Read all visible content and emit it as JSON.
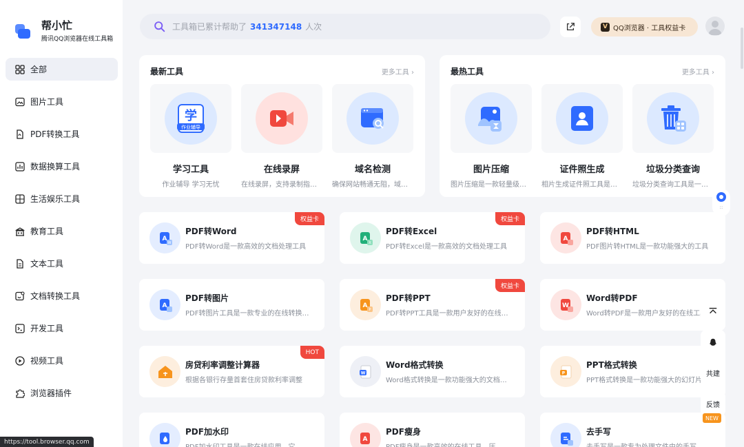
{
  "brand": {
    "title": "帮小忙",
    "subtitle": "腾讯QQ浏览器在线工具箱"
  },
  "nav": [
    {
      "label": "全部",
      "icon": "grid-icon",
      "active": true
    },
    {
      "label": "图片工具",
      "icon": "image-icon"
    },
    {
      "label": "PDF转换工具",
      "icon": "pdf-icon"
    },
    {
      "label": "数据换算工具",
      "icon": "chart-icon"
    },
    {
      "label": "生活娱乐工具",
      "icon": "gamepad-icon"
    },
    {
      "label": "教育工具",
      "icon": "building-icon"
    },
    {
      "label": "文本工具",
      "icon": "text-doc-icon"
    },
    {
      "label": "文档转换工具",
      "icon": "doc-convert-icon"
    },
    {
      "label": "开发工具",
      "icon": "code-icon"
    },
    {
      "label": "视频工具",
      "icon": "play-icon"
    },
    {
      "label": "浏览器插件",
      "icon": "puzzle-icon"
    }
  ],
  "search": {
    "prefix": "工具箱已累计帮助了",
    "count": "341347148",
    "suffix": "人次"
  },
  "header": {
    "vip_mark": "V",
    "vip_label": "QQ浏览器 · 工具权益卡"
  },
  "panels": [
    {
      "title": "最新工具",
      "more": "更多工具 ›",
      "items": [
        {
          "title": "学习工具",
          "desc": "作业辅导 学习无忧",
          "icon": "study-icon",
          "bg": "#dce9ff"
        },
        {
          "title": "在线录屏",
          "desc": "在线录屏，支持录制指定区域",
          "icon": "video-record-icon",
          "bg": "#ffe1df"
        },
        {
          "title": "域名检测",
          "desc": "确保网站畅通无阻，域名检测",
          "icon": "domain-check-icon",
          "bg": "#dce9ff"
        }
      ]
    },
    {
      "title": "最热工具",
      "more": "更多工具 ›",
      "items": [
        {
          "title": "图片压缩",
          "desc": "图片压缩是一款轻量级的工具",
          "icon": "image-compress-icon",
          "bg": "#dce9ff"
        },
        {
          "title": "证件照生成",
          "desc": "相片生成证件照工具是一款",
          "icon": "id-photo-icon",
          "bg": "#dce9ff"
        },
        {
          "title": "垃圾分类查询",
          "desc": "垃圾分类查询工具是一款工具",
          "icon": "trash-icon",
          "bg": "#dce9ff"
        }
      ]
    }
  ],
  "tools": [
    {
      "title": "PDF转Word",
      "desc": "PDF转Word是一款高效的文档处理工具",
      "badge": "权益卡",
      "badge_color": "red",
      "icon": "pdf-to-word-icon",
      "color": "#2f6bff",
      "bg": "#e4edff"
    },
    {
      "title": "PDF转Excel",
      "desc": "PDF转Excel是一款高效的文档处理工具",
      "badge": "权益卡",
      "badge_color": "red",
      "icon": "pdf-to-excel-icon",
      "color": "#22b07a",
      "bg": "#dff5ec"
    },
    {
      "title": "PDF转HTML",
      "desc": "PDF图片转HTML是一款功能强大的工具",
      "badge": "",
      "icon": "pdf-to-html-icon",
      "color": "#f0483e",
      "bg": "#fde5e3"
    },
    {
      "title": "PDF转图片",
      "desc": "PDF转图片工具是一款专业的在线转换工具",
      "badge": "",
      "icon": "pdf-to-image-icon",
      "color": "#2f6bff",
      "bg": "#e4edff"
    },
    {
      "title": "PDF转PPT",
      "desc": "PDF转PPT工具是一款用户友好的在线工具",
      "badge": "权益卡",
      "badge_color": "red",
      "icon": "pdf-to-ppt-icon",
      "color": "#f7941d",
      "bg": "#fdeede"
    },
    {
      "title": "Word转PDF",
      "desc": "Word转PDF是一款用户友好的在线工具",
      "badge": "",
      "icon": "word-to-pdf-icon",
      "color": "#f0483e",
      "bg": "#fde5e3"
    },
    {
      "title": "房贷利率调整计算器",
      "desc": "根据各银行存量首套住房贷款利率调整",
      "badge": "HOT",
      "badge_color": "red",
      "icon": "house-icon",
      "color": "#f7941d",
      "bg": "#fdeede"
    },
    {
      "title": "Word格式转换",
      "desc": "Word格式转换是一款功能强大的文档工具",
      "badge": "",
      "icon": "word-format-icon",
      "color": "#2f6bff",
      "bg": "#eef0f6"
    },
    {
      "title": "PPT格式转换",
      "desc": "PPT格式转换是一款功能强大的幻灯片工具",
      "badge": "",
      "icon": "ppt-format-icon",
      "color": "#f7941d",
      "bg": "#fdeede"
    },
    {
      "title": "PDF加水印",
      "desc": "PDF加水印工具是一款在线应用，它",
      "badge": "",
      "icon": "watermark-icon",
      "color": "#2f6bff",
      "bg": "#e4edff"
    },
    {
      "title": "PDF瘦身",
      "desc": "PDF瘦身是一款高效的在线工具，压",
      "badge": "",
      "icon": "pdf-compress-icon",
      "color": "#f0483e",
      "bg": "#fde5e3"
    },
    {
      "title": "去手写",
      "desc": "去手写是一款专为处理文件中的手写",
      "badge": "",
      "icon": "remove-handwriting-icon",
      "color": "#2f6bff",
      "bg": "#e4edff"
    }
  ],
  "float": {
    "cobuild": "共建",
    "feedback": "反馈",
    "new_tag": "NEW"
  },
  "status_url": "https://tool.browser.qq.com"
}
